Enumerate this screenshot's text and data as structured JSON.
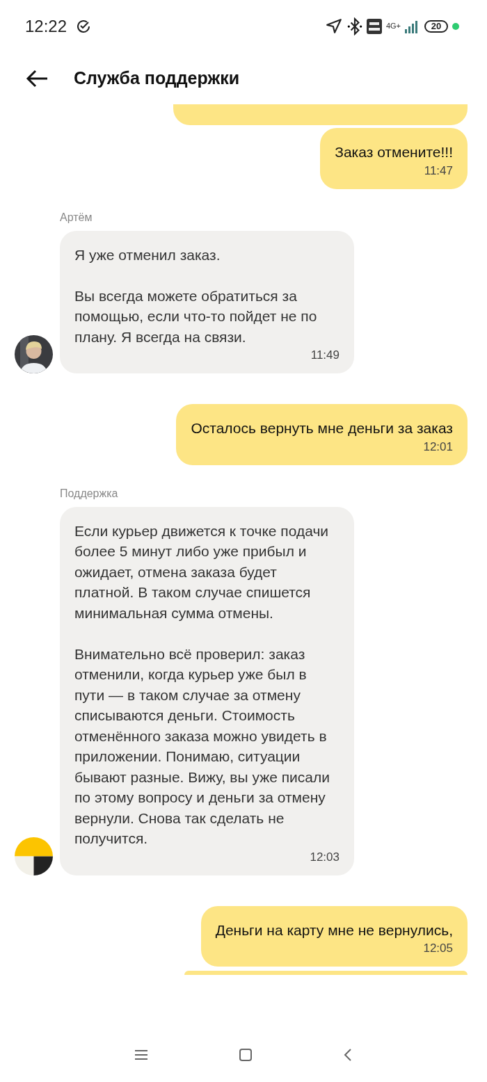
{
  "status_bar": {
    "time": "12:22",
    "network": "4G+",
    "battery": "20"
  },
  "header": {
    "title": "Служба поддержки"
  },
  "messages": [
    {
      "kind": "outgoing",
      "text": "Заказ отмените!!!",
      "time": "11:47"
    },
    {
      "kind": "incoming",
      "author": "Артём",
      "avatar": {
        "kind": "photo"
      },
      "text": "Я уже отменил заказ.\n\nВы всегда можете обратиться за помощью, если что-то пойдет не по плану. Я всегда на связи.",
      "time": "11:49"
    },
    {
      "kind": "outgoing",
      "text": "Осталось вернуть мне деньги за заказ",
      "time": "12:01"
    },
    {
      "kind": "incoming",
      "author": "Поддержка",
      "avatar": {
        "kind": "logo"
      },
      "text": "Если курьер движется к точке подачи более 5 минут либо уже прибыл и ожидает, отмена заказа будет платной. В таком случае спишется минимальная сумма отмены.\n\nВнимательно всё проверил: заказ отменили, когда курьер уже был в пути — в таком случае за отмену списываются деньги. Стоимость отменённого заказа можно увидеть в приложении. Понимаю, ситуации бывают разные. Вижу, вы уже писали по этому вопросу и деньги за отмену вернули. Снова так сделать не получится.",
      "time": "12:03"
    },
    {
      "kind": "outgoing",
      "text": "Деньги на карту мне не вернулись,",
      "time": "12:05"
    }
  ]
}
